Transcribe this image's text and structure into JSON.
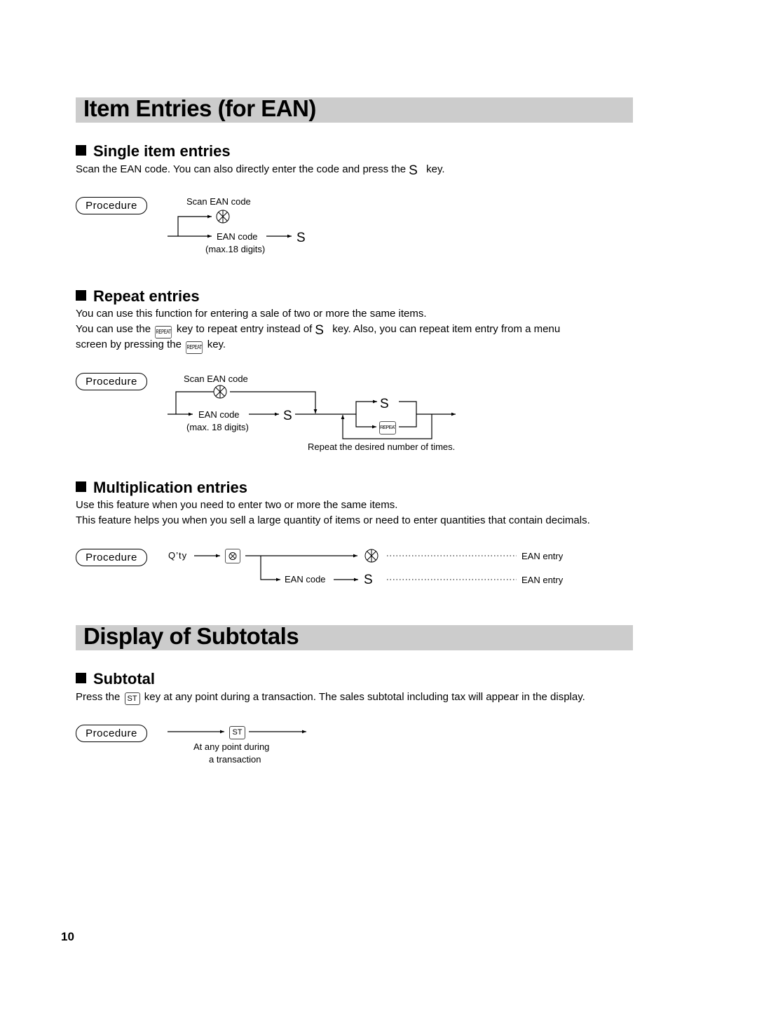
{
  "sections": [
    {
      "title": "Item Entries (for EAN)",
      "subsections": [
        {
          "heading": "Single item entries",
          "text_before_key": "Scan the EAN code. You can also directly enter the code and press the",
          "key": "S",
          "text_after_key": "key.",
          "procedure": {
            "label": "Procedure",
            "scan_label": "Scan EAN code",
            "code_label": "EAN code",
            "code_note": "(max.18 digits)",
            "key": "S"
          }
        },
        {
          "heading": "Repeat entries",
          "line1": "You can use this function for entering a sale of two or more the same items.",
          "line2_a": "You can use the",
          "repeat_key": "REPEAT",
          "line2_b": "key to repeat entry instead of",
          "s_key": "S",
          "line2_c": "key. Also, you can repeat item entry from a menu",
          "line3_a": "screen by pressing the",
          "line3_b": "key.",
          "procedure": {
            "label": "Procedure",
            "scan_label": "Scan EAN code",
            "code_label": "EAN code",
            "code_note": "(max. 18 digits)",
            "key": "S",
            "loop_key_s": "S",
            "loop_key_repeat": "REPEAT",
            "loop_note": "Repeat the desired number of times."
          }
        },
        {
          "heading": "Multiplication entries",
          "line1": "Use this feature when you need to enter two or more the same items.",
          "line2": "This feature helps you when you sell a large quantity of items or need to enter quantities that contain decimals.",
          "procedure": {
            "label": "Procedure",
            "qty_label": "Q’ty",
            "code_label": "EAN code",
            "key": "S",
            "result_1": "EAN entry",
            "result_2": "EAN entry"
          }
        }
      ]
    },
    {
      "title": "Display of Subtotals",
      "subsections": [
        {
          "heading": "Subtotal",
          "text_a": "Press the",
          "key": "ST",
          "text_b": "key at any point during a transaction. The sales subtotal including tax will appear in the display.",
          "procedure": {
            "label": "Procedure",
            "key": "ST",
            "note_line1": "At any point during",
            "note_line2": "a transaction"
          }
        }
      ]
    }
  ],
  "page_number": "10"
}
